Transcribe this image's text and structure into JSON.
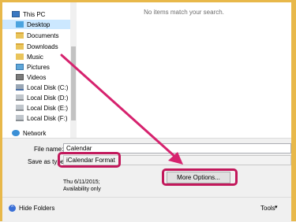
{
  "nav": {
    "this_pc": "This PC",
    "items": [
      {
        "label": "Desktop",
        "icon": "desktop-icon"
      },
      {
        "label": "Documents",
        "icon": "documents-folder-icon"
      },
      {
        "label": "Downloads",
        "icon": "downloads-folder-icon"
      },
      {
        "label": "Music",
        "icon": "music-folder-icon"
      },
      {
        "label": "Pictures",
        "icon": "pictures-folder-icon"
      },
      {
        "label": "Videos",
        "icon": "videos-folder-icon"
      },
      {
        "label": "Local Disk (C:)",
        "icon": "drive-c-icon"
      },
      {
        "label": "Local Disk (D:)",
        "icon": "drive-icon"
      },
      {
        "label": "Local Disk (E:)",
        "icon": "drive-icon"
      },
      {
        "label": "Local Disk (F:)",
        "icon": "drive-icon"
      }
    ],
    "network": "Network"
  },
  "content": {
    "empty_message": "No items match your search."
  },
  "form": {
    "file_name_label": "File name:",
    "file_name_value": "Calendar",
    "save_as_type_label": "Save as type:",
    "save_as_type_value": "iCalendar Format",
    "date_text": "Thu 6/11/2015;",
    "availability_text": "Availability only",
    "more_options_label": "More Options..."
  },
  "bottom": {
    "hide_folders_label": "Hide Folders",
    "tools_label": "Tools"
  },
  "colors": {
    "accent": "#c2185b",
    "frame": "#e8b84a",
    "selection": "#cce8ff"
  }
}
